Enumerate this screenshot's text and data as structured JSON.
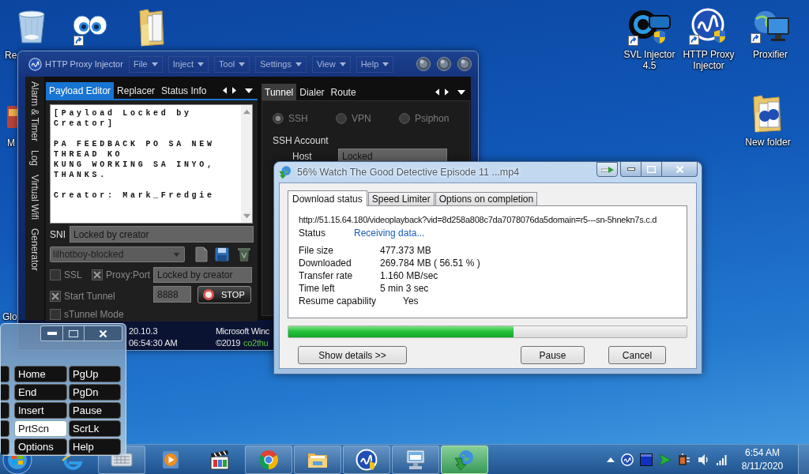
{
  "desktop_icons": [
    {
      "label": "Re"
    },
    {
      "label": "M"
    },
    {
      "label": "Glo"
    },
    {
      "label": "SVL Injector 4.5"
    },
    {
      "label": "HTTP Proxy Injector"
    },
    {
      "label": "Proxifier"
    },
    {
      "label": "New folder"
    }
  ],
  "proxy_window": {
    "title": "HTTP Proxy Injector",
    "menus": [
      "File",
      "Inject",
      "Tool",
      "Settings",
      "View",
      "Help"
    ],
    "side_tabs": [
      "Alarm & Timer",
      "Log",
      "Virtual Wifi",
      "Generator"
    ],
    "left_tabs": [
      {
        "label": "Payload Editor",
        "selected": true
      },
      {
        "label": "Replacer",
        "selected": false
      },
      {
        "label": "Status Info",
        "selected": false
      }
    ],
    "payload": "[Payload Locked by Creator]\n\nPA FEEDBACK PO SA NEW THREAD KO\nKUNG WORKING SA INYO, THANKS.\n\nCreator: Mark_Fredgie",
    "sni": {
      "label": "SNI",
      "value": "Locked by creator"
    },
    "config": {
      "value": "lilhotboy-blocked"
    },
    "options": [
      {
        "label": "SSL",
        "checked": false
      },
      {
        "label": "Proxy:Port",
        "checked": true
      },
      {
        "label": "Start Tunnel",
        "checked": true
      },
      {
        "label": "sTunnel Mode",
        "checked": false
      }
    ],
    "proxy_value": "Locked by creator",
    "port_value": "8888",
    "stop_label": "STOP",
    "right_tabs": [
      {
        "label": "Tunnel",
        "selected": true
      },
      {
        "label": "Dialer",
        "selected": false
      },
      {
        "label": "Route",
        "selected": false
      }
    ],
    "modes": [
      {
        "label": "SSH",
        "selected": true
      },
      {
        "label": "VPN",
        "selected": false
      },
      {
        "label": "Psiphon",
        "selected": false
      }
    ],
    "account_heading": "SSH Account",
    "host": {
      "label": "Host",
      "value": "Locked"
    },
    "status_bar": {
      "version": "20.10.3",
      "time": "06:54:30 AM",
      "system": "Microsoft Winc",
      "copyright": "©2019",
      "author": "co2thu"
    }
  },
  "download_dialog": {
    "title": "56% Watch The Good Detective Episode 11 ...mp4",
    "tabs": [
      {
        "label": "Download status",
        "selected": true
      },
      {
        "label": "Speed Limiter",
        "selected": false
      },
      {
        "label": "Options on completion",
        "selected": false
      }
    ],
    "url": "http://51.15.64.180/videoplayback?vid=8d258a808c7da7078076da5domain=r5---sn-5hnekn7s.c.d",
    "status": {
      "label": "Status",
      "value": "Receiving data..."
    },
    "details": [
      {
        "label": "File size",
        "value": "477.373 MB"
      },
      {
        "label": "Downloaded",
        "value": "269.784 MB ( 56.51 % )"
      },
      {
        "label": "Transfer rate",
        "value": "1.160 MB/sec"
      },
      {
        "label": "Time left",
        "value": "5 min 3 sec"
      }
    ],
    "resume": {
      "label": "Resume capability",
      "value": "Yes"
    },
    "progress": {
      "level": 0.5651
    },
    "buttons": [
      "Show details >>",
      "Pause",
      "Cancel"
    ]
  },
  "keyboard": {
    "keys": [
      {
        "label": "Home",
        "selected": false
      },
      {
        "label": "PgUp",
        "selected": false
      },
      {
        "label": "End",
        "selected": false
      },
      {
        "label": "PgDn",
        "selected": false
      },
      {
        "label": "Insert",
        "selected": false
      },
      {
        "label": "Pause",
        "selected": false
      },
      {
        "label": "PrtScn",
        "selected": true
      },
      {
        "label": "ScrLk",
        "selected": false
      },
      {
        "label": "Options",
        "selected": false
      },
      {
        "label": "Help",
        "selected": false
      }
    ]
  },
  "taskbar": {
    "buttons": [
      {
        "running": false,
        "highlighted": false
      },
      {
        "running": true,
        "highlighted": false
      },
      {
        "running": false,
        "highlighted": false
      },
      {
        "running": false,
        "highlighted": false
      },
      {
        "running": true,
        "highlighted": false
      },
      {
        "running": true,
        "highlighted": false
      },
      {
        "running": true,
        "highlighted": false
      },
      {
        "running": true,
        "highlighted": false
      },
      {
        "running": true,
        "highlighted": true
      }
    ],
    "clock": {
      "time": "6:54 AM",
      "date": "8/11/2020"
    }
  }
}
